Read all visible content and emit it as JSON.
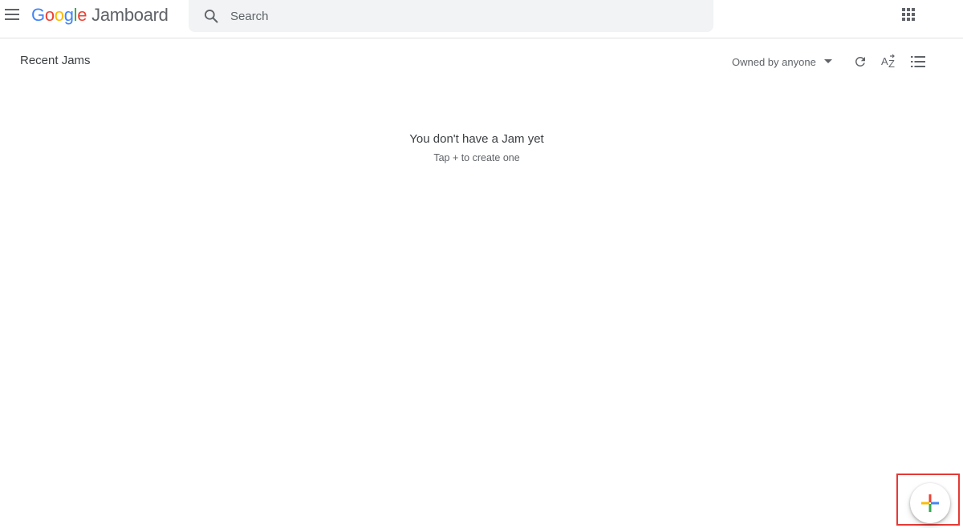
{
  "app": {
    "logo_letters": [
      {
        "char": "G",
        "color": "#4285f4"
      },
      {
        "char": "o",
        "color": "#ea4335"
      },
      {
        "char": "o",
        "color": "#fbbc05"
      },
      {
        "char": "g",
        "color": "#4285f4"
      },
      {
        "char": "l",
        "color": "#34a853"
      },
      {
        "char": "e",
        "color": "#ea4335"
      }
    ],
    "product_name": "Jamboard"
  },
  "header": {
    "menu_icon": "hamburger-menu-icon",
    "search_icon": "search-icon",
    "search_placeholder": "Search",
    "apps_icon": "apps-grid-icon"
  },
  "toolbar": {
    "page_title": "Recent Jams",
    "owner_filter_label": "Owned by anyone",
    "owner_filter_icon": "caret-down-icon",
    "refresh_icon": "refresh-icon",
    "sort_icon": "sort-az-icon",
    "view_icon": "list-view-icon"
  },
  "empty_state": {
    "title": "You don't have a Jam yet",
    "subtitle": "Tap + to create one"
  },
  "fab": {
    "icon": "plus-icon",
    "highlight_color": "#e53935",
    "plus_colors": [
      "#4285f4",
      "#ea4335",
      "#fbbc05",
      "#34a853"
    ]
  },
  "colors": {
    "text_primary": "#3c4043",
    "text_secondary": "#5f6368",
    "search_bg": "#f1f3f4",
    "divider": "#e0e0e0"
  }
}
